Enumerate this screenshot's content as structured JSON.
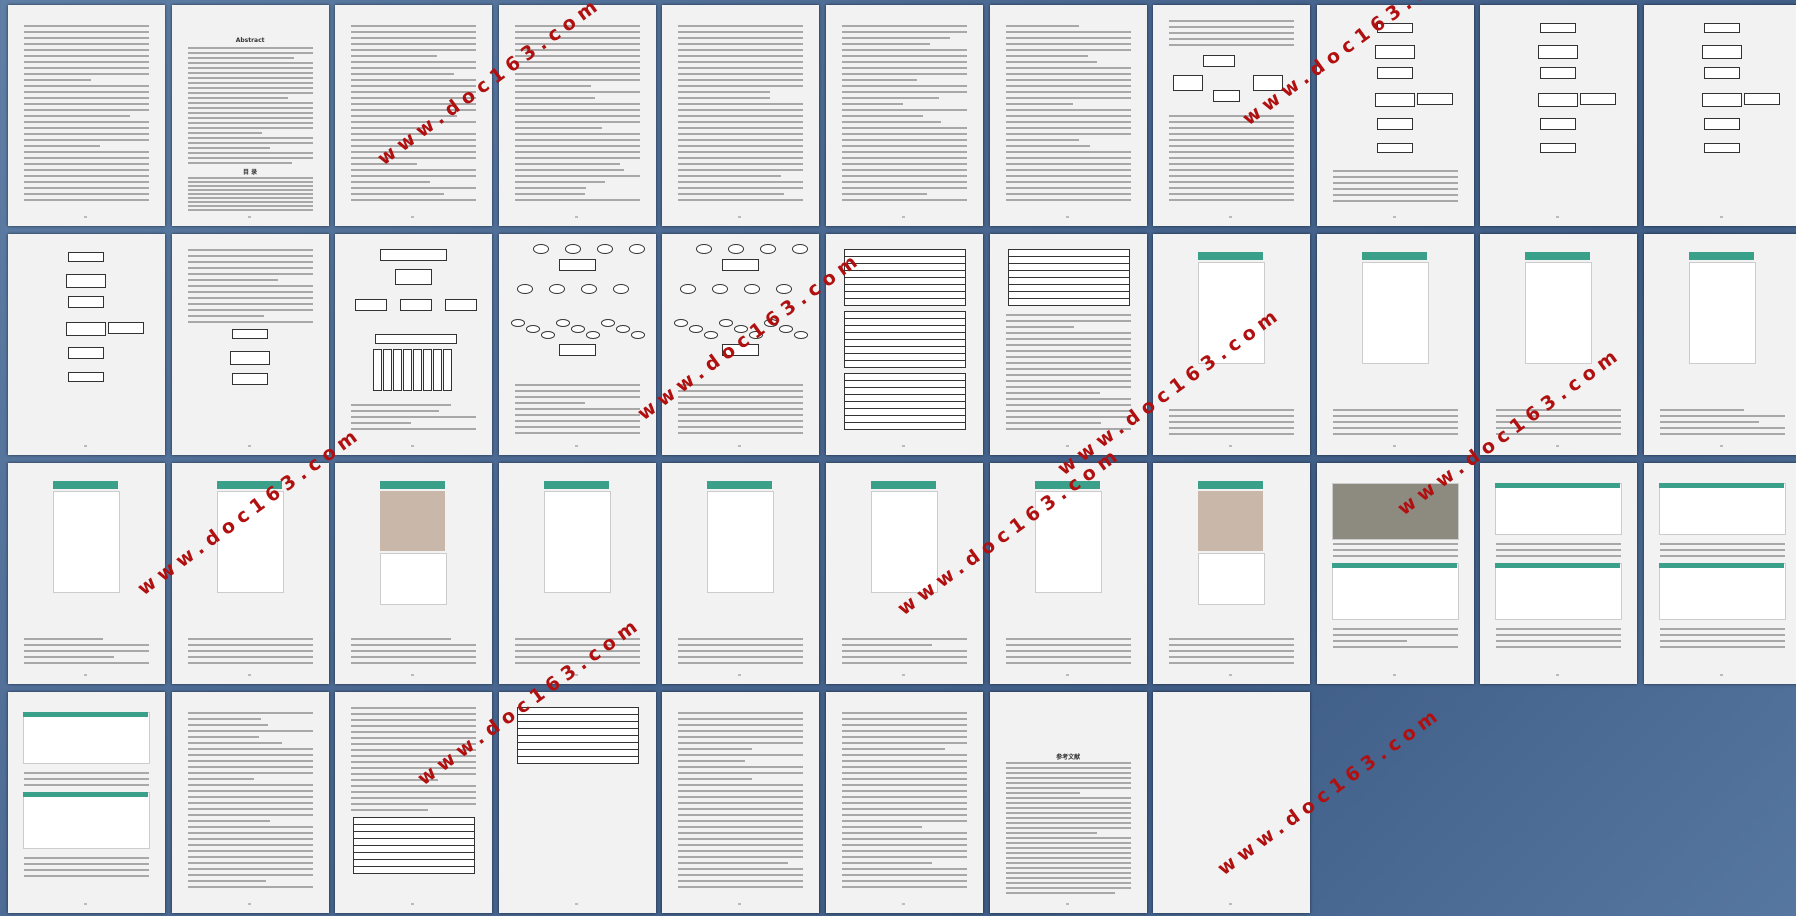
{
  "viewer": {
    "background": "#4a6891",
    "page_color": "#f2f2f2"
  },
  "watermark": {
    "text": "www.doc163.com",
    "color": "#b01010"
  },
  "pages": [
    {
      "type": "text"
    },
    {
      "type": "abstract-toc",
      "title": "Abstract",
      "toc_title": "目 录"
    },
    {
      "type": "toc"
    },
    {
      "type": "text"
    },
    {
      "type": "text"
    },
    {
      "type": "text"
    },
    {
      "type": "text"
    },
    {
      "type": "text-diagram"
    },
    {
      "type": "flow-text"
    },
    {
      "type": "flow"
    },
    {
      "type": "flow"
    },
    {
      "type": "flow"
    },
    {
      "type": "text-flow"
    },
    {
      "type": "tree"
    },
    {
      "type": "er"
    },
    {
      "type": "er"
    },
    {
      "type": "tables"
    },
    {
      "type": "table-text"
    },
    {
      "type": "phone"
    },
    {
      "type": "phone"
    },
    {
      "type": "phone"
    },
    {
      "type": "phone"
    },
    {
      "type": "phone"
    },
    {
      "type": "phone"
    },
    {
      "type": "phone-photo"
    },
    {
      "type": "phone"
    },
    {
      "type": "phone"
    },
    {
      "type": "phone"
    },
    {
      "type": "phone"
    },
    {
      "type": "phone-photo"
    },
    {
      "type": "web-photo"
    },
    {
      "type": "web"
    },
    {
      "type": "web"
    },
    {
      "type": "web"
    },
    {
      "type": "text"
    },
    {
      "type": "text-table"
    },
    {
      "type": "table"
    },
    {
      "type": "text"
    },
    {
      "type": "text"
    },
    {
      "type": "refs",
      "title": "参考文献"
    },
    {
      "type": "blank"
    }
  ]
}
